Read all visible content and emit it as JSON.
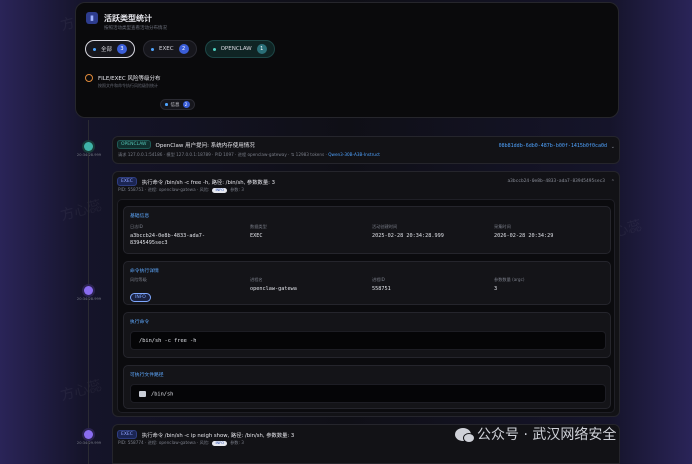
{
  "stats": {
    "title": "活跃类型统计",
    "subtitle": "按照活动类型查看活动分布情况",
    "chips": [
      {
        "label": "全部",
        "count": "3",
        "active": true
      },
      {
        "label": "EXEC",
        "count": "2"
      },
      {
        "label": "OPENCLAW",
        "count": "1"
      }
    ],
    "risk_title": "FILE/EXEC 风险等级分布",
    "risk_subtitle": "按照文件和命令执行风险级别统计",
    "risk_chip": {
      "label": "信息",
      "count": "2"
    }
  },
  "timeline": {
    "times": [
      "20:34:28.999",
      "20:34:28.999",
      "20:34:29.999"
    ]
  },
  "openclaw": {
    "tag": "OPENCLAW",
    "title": "OpenClaw 用户提问: 系统内存使用情况",
    "meta_prefix": "请求 127.0.0.1:54186 · 模型 127.0.0.1:18789 · PID 1097 · 进程 openclaw-gateway · ⇅ 12983 tokens ·",
    "model": "Qwen3-30B-A3B-Instruct",
    "id": "08b81ddb-6db0-487b-b00f-1415b0f0ca0d"
  },
  "exec": {
    "tag": "EXEC",
    "title": "执行命令 /bin/sh -c free -h, 路径: /bin/sh, 参数数量: 3",
    "pid": "PID: 558751 · 进程: openclaw-gatewa · 风险:",
    "risk": "INFO",
    "args": "参数: 3",
    "id": "a3bccb24-0e8b-4833-ada7-83945495sec3",
    "basic": {
      "title": "基础信息",
      "log_id_label": "日志ID",
      "log_id": "a3bccb24-0e8b-4833-ada7-83945495sec3",
      "type_label": "数据类型",
      "type": "EXEC",
      "time_label": "活动创建时间",
      "time": "2025-02-28 20:34:28.999",
      "rec_label": "采集时间",
      "rec": "2026-02-28 20:34:29"
    },
    "detail": {
      "title": "命令执行详情",
      "risk_label": "风险等级",
      "risk": "INFO",
      "proc_label": "进程名",
      "proc": "openclaw-gatewa",
      "pid_label": "进程ID",
      "pid": "558751",
      "argc_label": "参数数量 (argc)",
      "argc": "3"
    },
    "command": {
      "title": "执行命令",
      "value": "/bin/sh -c free -h"
    },
    "file": {
      "title": "可执行文件路径",
      "value": "/bin/sh"
    }
  },
  "exec2": {
    "tag": "EXEC",
    "title": "执行命令 /bin/sh -c ip neigh show, 路径: /bin/sh, 参数数量: 3",
    "pid": "PID: 558774 · 进程: openclaw-gatewa · 风险:",
    "risk": "INFO",
    "args": "参数: 3"
  },
  "brand": "公众号 · 武汉网络安全",
  "watermark": "方心蕊"
}
